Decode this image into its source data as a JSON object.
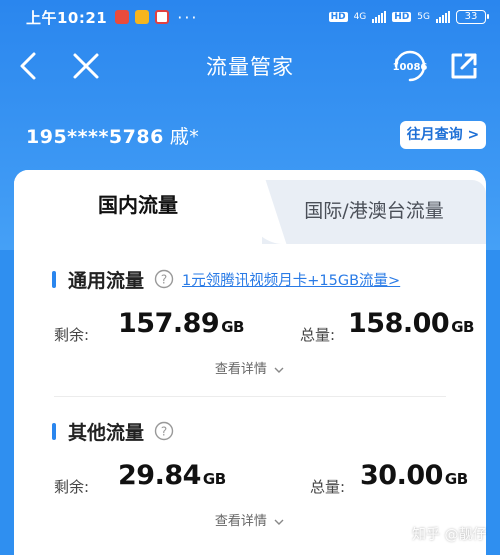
{
  "status_bar": {
    "time": "上午10:21",
    "dots": "···",
    "net1": "4G",
    "net2": "5G",
    "hd": "HD",
    "battery": "33"
  },
  "nav": {
    "title": "流量管家",
    "service_number": "10086"
  },
  "account": {
    "number": "195****5786",
    "name": "戚*",
    "monthly_query_label": "往月查询 >"
  },
  "tabs": {
    "domestic": "国内流量",
    "international": "国际/港澳台流量"
  },
  "general_data": {
    "title": "通用流量",
    "promo": "1元领腾讯视频月卡+15GB流量>",
    "remaining_label": "剩余:",
    "remaining_value": "157.89",
    "remaining_unit": "GB",
    "total_label": "总量:",
    "total_value": "158.00",
    "total_unit": "GB",
    "detail_label": "查看详情"
  },
  "other_data": {
    "title": "其他流量",
    "remaining_label": "剩余:",
    "remaining_value": "29.84",
    "remaining_unit": "GB",
    "total_label": "总量:",
    "total_value": "30.00",
    "total_unit": "GB",
    "detail_label": "查看详情"
  },
  "watermark": "知乎 @靓仔",
  "colors": {
    "brand_blue": "#2a86ee",
    "link_blue": "#2a7be6",
    "tab_inactive_bg": "#e9eef5"
  },
  "icons": {
    "back": "chevron-left-icon",
    "close": "close-icon",
    "service": "phone-10086-icon",
    "share": "share-icon",
    "help": "question-circle-icon",
    "expand": "chevron-down-icon"
  }
}
